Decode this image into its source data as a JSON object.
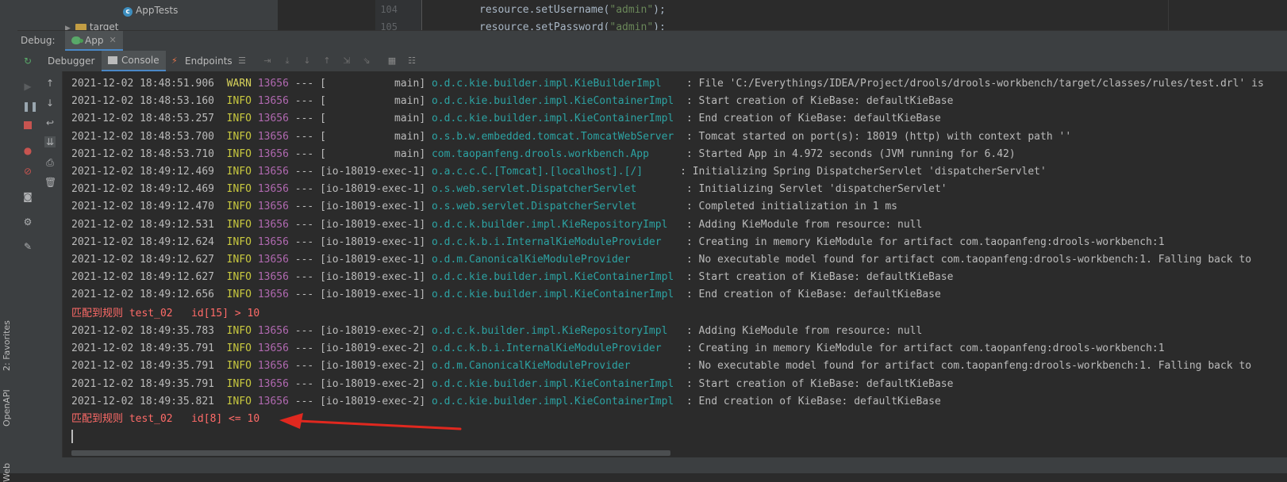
{
  "editor": {
    "project_tree": {
      "item_apptests": "AppTests",
      "item_target": "target"
    },
    "line_numbers": [
      "104",
      "105"
    ],
    "code_lines": [
      {
        "pre": "resource.setUsername(",
        "str": "\"admin\"",
        "post": ");"
      },
      {
        "pre": "resource.setPassword(",
        "str": "\"admin\"",
        "post": ");"
      }
    ]
  },
  "debug_window": {
    "label": "Debug:",
    "run_tab": "App",
    "tabs": [
      "Debugger",
      "Console",
      "Endpoints"
    ]
  },
  "side_tools": {
    "favorites": "2: Favorites",
    "openapi": "OpenAPI",
    "web": "Web"
  },
  "console": {
    "log_lines": [
      {
        "ts": "2021-12-02 18:48:51.906",
        "level": "WARN",
        "pid": "13656",
        "sep": "---",
        "thread": "[           main]",
        "logger": "o.d.c.kie.builder.impl.KieBuilderImpl   ",
        "msg": ": File 'C:/Everythings/IDEA/Project/drools/drools-workbench/target/classes/rules/test.drl' is"
      },
      {
        "ts": "2021-12-02 18:48:53.160",
        "level": "INFO",
        "pid": "13656",
        "sep": "---",
        "thread": "[           main]",
        "logger": "o.d.c.kie.builder.impl.KieContainerImpl ",
        "msg": ": Start creation of KieBase: defaultKieBase"
      },
      {
        "ts": "2021-12-02 18:48:53.257",
        "level": "INFO",
        "pid": "13656",
        "sep": "---",
        "thread": "[           main]",
        "logger": "o.d.c.kie.builder.impl.KieContainerImpl ",
        "msg": ": End creation of KieBase: defaultKieBase"
      },
      {
        "ts": "2021-12-02 18:48:53.700",
        "level": "INFO",
        "pid": "13656",
        "sep": "---",
        "thread": "[           main]",
        "logger": "o.s.b.w.embedded.tomcat.TomcatWebServer ",
        "msg": ": Tomcat started on port(s): 18019 (http) with context path ''"
      },
      {
        "ts": "2021-12-02 18:48:53.710",
        "level": "INFO",
        "pid": "13656",
        "sep": "---",
        "thread": "[           main]",
        "logger": "com.taopanfeng.drools.workbench.App     ",
        "msg": ": Started App in 4.972 seconds (JVM running for 6.42)"
      },
      {
        "ts": "2021-12-02 18:49:12.469",
        "level": "INFO",
        "pid": "13656",
        "sep": "---",
        "thread": "[io-18019-exec-1]",
        "logger": "o.a.c.c.C.[Tomcat].[localhost].[/]     ",
        "msg": ": Initializing Spring DispatcherServlet 'dispatcherServlet'"
      },
      {
        "ts": "2021-12-02 18:49:12.469",
        "level": "INFO",
        "pid": "13656",
        "sep": "---",
        "thread": "[io-18019-exec-1]",
        "logger": "o.s.web.servlet.DispatcherServlet       ",
        "msg": ": Initializing Servlet 'dispatcherServlet'"
      },
      {
        "ts": "2021-12-02 18:49:12.470",
        "level": "INFO",
        "pid": "13656",
        "sep": "---",
        "thread": "[io-18019-exec-1]",
        "logger": "o.s.web.servlet.DispatcherServlet       ",
        "msg": ": Completed initialization in 1 ms"
      },
      {
        "ts": "2021-12-02 18:49:12.531",
        "level": "INFO",
        "pid": "13656",
        "sep": "---",
        "thread": "[io-18019-exec-1]",
        "logger": "o.d.c.k.builder.impl.KieRepositoryImpl  ",
        "msg": ": Adding KieModule from resource: null"
      },
      {
        "ts": "2021-12-02 18:49:12.624",
        "level": "INFO",
        "pid": "13656",
        "sep": "---",
        "thread": "[io-18019-exec-1]",
        "logger": "o.d.c.k.b.i.InternalKieModuleProvider   ",
        "msg": ": Creating in memory KieModule for artifact com.taopanfeng:drools-workbench:1"
      },
      {
        "ts": "2021-12-02 18:49:12.627",
        "level": "INFO",
        "pid": "13656",
        "sep": "---",
        "thread": "[io-18019-exec-1]",
        "logger": "o.d.m.CanonicalKieModuleProvider        ",
        "msg": ": No executable model found for artifact com.taopanfeng:drools-workbench:1. Falling back to"
      },
      {
        "ts": "2021-12-02 18:49:12.627",
        "level": "INFO",
        "pid": "13656",
        "sep": "---",
        "thread": "[io-18019-exec-1]",
        "logger": "o.d.c.kie.builder.impl.KieContainerImpl ",
        "msg": ": Start creation of KieBase: defaultKieBase"
      },
      {
        "ts": "2021-12-02 18:49:12.656",
        "level": "INFO",
        "pid": "13656",
        "sep": "---",
        "thread": "[io-18019-exec-1]",
        "logger": "o.d.c.kie.builder.impl.KieContainerImpl ",
        "msg": ": End creation of KieBase: defaultKieBase"
      }
    ],
    "match_line_1": "匹配到规则 test_02   id[15] > 10",
    "log_lines_2": [
      {
        "ts": "2021-12-02 18:49:35.783",
        "level": "INFO",
        "pid": "13656",
        "sep": "---",
        "thread": "[io-18019-exec-2]",
        "logger": "o.d.c.k.builder.impl.KieRepositoryImpl  ",
        "msg": ": Adding KieModule from resource: null"
      },
      {
        "ts": "2021-12-02 18:49:35.791",
        "level": "INFO",
        "pid": "13656",
        "sep": "---",
        "thread": "[io-18019-exec-2]",
        "logger": "o.d.c.k.b.i.InternalKieModuleProvider   ",
        "msg": ": Creating in memory KieModule for artifact com.taopanfeng:drools-workbench:1"
      },
      {
        "ts": "2021-12-02 18:49:35.791",
        "level": "INFO",
        "pid": "13656",
        "sep": "---",
        "thread": "[io-18019-exec-2]",
        "logger": "o.d.m.CanonicalKieModuleProvider        ",
        "msg": ": No executable model found for artifact com.taopanfeng:drools-workbench:1. Falling back to"
      },
      {
        "ts": "2021-12-02 18:49:35.791",
        "level": "INFO",
        "pid": "13656",
        "sep": "---",
        "thread": "[io-18019-exec-2]",
        "logger": "o.d.c.kie.builder.impl.KieContainerImpl ",
        "msg": ": Start creation of KieBase: defaultKieBase"
      },
      {
        "ts": "2021-12-02 18:49:35.821",
        "level": "INFO",
        "pid": "13656",
        "sep": "---",
        "thread": "[io-18019-exec-2]",
        "logger": "o.d.c.kie.builder.impl.KieContainerImpl ",
        "msg": ": End creation of KieBase: defaultKieBase"
      }
    ],
    "match_line_2": "匹配到规则 test_02   id[8] <= 10"
  },
  "colors": {
    "background": "#2b2b2b",
    "panel": "#3c3f41",
    "accent_tab": "#4a88c7",
    "info_level": "#c9c93f",
    "pid": "#b069b0",
    "logger": "#2ca3a3",
    "match_text": "#ff6b68",
    "annotation_arrow": "#e0281f"
  },
  "icons": {
    "left_toolbar": [
      "rerun-icon",
      "resume-icon",
      "pause-icon",
      "stop-icon",
      "view-breakpoints-icon",
      "mute-breakpoints-icon",
      "camera-icon",
      "settings-icon",
      "pin-icon"
    ],
    "console_toolbar": [
      "up-arrow-icon",
      "down-arrow-icon",
      "soft-wrap-icon",
      "scroll-to-end-icon",
      "print-icon",
      "trash-icon"
    ]
  }
}
